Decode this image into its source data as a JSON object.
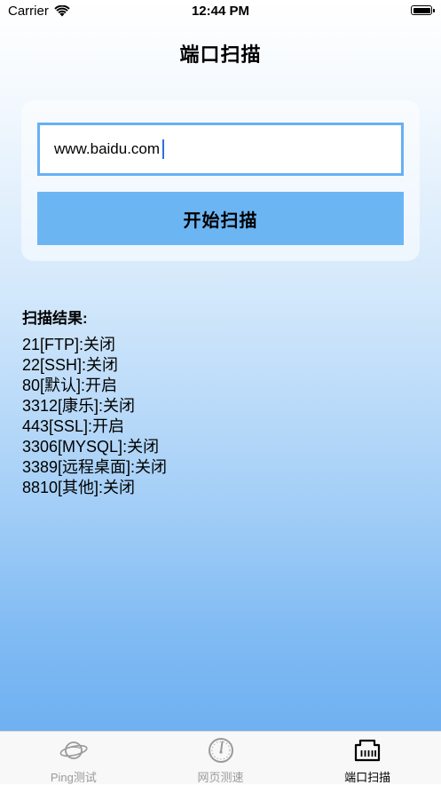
{
  "status_bar": {
    "carrier": "Carrier",
    "time": "12:44 PM"
  },
  "nav": {
    "title": "端口扫描"
  },
  "scan_form": {
    "url_value": "www.baidu.com",
    "start_label": "开始扫描"
  },
  "results": {
    "title": "扫描结果:",
    "items": [
      "21[FTP]:关闭",
      "22[SSH]:关闭",
      "80[默认]:开启",
      "3312[康乐]:关闭",
      "443[SSL]:开启",
      "3306[MYSQL]:关闭",
      "3389[远程桌面]:关闭",
      "8810[其他]:关闭"
    ]
  },
  "tabs": [
    {
      "label": "Ping测试",
      "icon": "planet-icon",
      "active": false
    },
    {
      "label": "网页测速",
      "icon": "speedometer-icon",
      "active": false
    },
    {
      "label": "端口扫描",
      "icon": "ethernet-port-icon",
      "active": true
    }
  ],
  "colors": {
    "accent": "#6cb5f3",
    "input_border": "#67b0f3",
    "tab_inactive": "#9a9a9a"
  }
}
